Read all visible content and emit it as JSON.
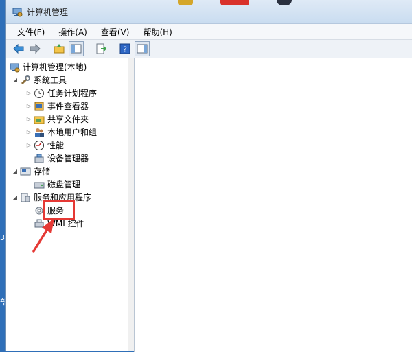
{
  "window": {
    "title": "计算机管理"
  },
  "menu": [
    "文件(F)",
    "操作(A)",
    "查看(V)",
    "帮助(H)"
  ],
  "toolbar": [
    "back-icon",
    "forward-icon",
    "up-folder-icon",
    "show-hide-tree-icon",
    "export-list-icon",
    "help-icon",
    "action-pane-icon"
  ],
  "tree": {
    "root": "计算机管理(本地)",
    "system_tools": "系统工具",
    "task_scheduler": "任务计划程序",
    "event_viewer": "事件查看器",
    "shared_folders": "共享文件夹",
    "local_users": "本地用户和组",
    "performance": "性能",
    "device_manager": "设备管理器",
    "storage": "存储",
    "disk_management": "磁盘管理",
    "services_apps": "服务和应用程序",
    "services": "服务",
    "wmi_control": "WMI 控件"
  },
  "desktop": {
    "left_glyph_top": "3",
    "left_glyph_bottom": "部"
  },
  "colors": {
    "highlight": "#e53935",
    "desktop": "#2f6fb8"
  }
}
